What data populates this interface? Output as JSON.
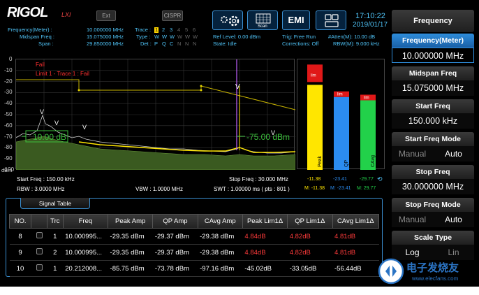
{
  "header": {
    "logo": "RIGOL",
    "logo_sub": "LXI",
    "btn_ext": "Ext",
    "btn_cispr": "CISPR",
    "scan_label": "Scan",
    "emi_label": "EMI",
    "time": "17:10:22",
    "date": "2019/01/17",
    "freq_meter_label": "Frequency(Meter) :",
    "freq_meter_value": "10.000000 MHz",
    "midspan_label": "Midspan Freq :",
    "midspan_value": "15.075000 MHz",
    "span_label": "Span :",
    "span_value": "29.850000 MHz",
    "trace_label": "Trace :",
    "trace_nums": [
      "1",
      "2",
      "3",
      "4",
      "5",
      "6"
    ],
    "type_label": "Type :",
    "type_vals": [
      "W",
      "W",
      "W",
      "W",
      "W",
      "W"
    ],
    "det_label": "Det :",
    "det_vals": [
      "P",
      "Q",
      "C",
      "N",
      "N",
      "N"
    ],
    "ref_level": "Ref Level: 0.00 dBm",
    "state": "State: Idle",
    "trig": "Trig: Free Run",
    "corrections": "Corrections: Off",
    "atten": "#Atten(M): 10.00 dB",
    "rbw_m": "RBW(M): 9.000 kHz"
  },
  "right_panel": {
    "title": "Frequency",
    "items": [
      {
        "label": "Frequency(Meter)",
        "value": "10.000000 MHz"
      },
      {
        "label": "Midspan Freq",
        "value": "15.075000 MHz"
      },
      {
        "label": "Start Freq",
        "value": "150.000 kHz"
      },
      {
        "label": "Start Freq Mode",
        "opt1": "Manual",
        "opt2": "Auto"
      },
      {
        "label": "Stop Freq",
        "value": "30.000000 MHz"
      },
      {
        "label": "Stop Freq Mode",
        "opt1": "Manual",
        "opt2": "Auto"
      },
      {
        "label": "Scale Type",
        "opt1": "Log",
        "opt2": "Lin"
      }
    ]
  },
  "plot": {
    "y_ticks": [
      "0",
      "-10",
      "-20",
      "-30",
      "-40",
      "-50",
      "-60",
      "-70",
      "-80",
      "-90",
      "-100"
    ],
    "y_unit": "dBm",
    "fail_text": "Fail",
    "limit_text": "Limit 1 - Trace 1 : Fail",
    "left_readout": "10.00 dB",
    "right_readout": "-75.00 dBm",
    "start_freq": "Start Freq : 150.00 kHz",
    "rbw": "RBW : 3.0000 MHz",
    "vbw": "VBW : 1.0000 MHz",
    "stop_freq": "Stop Freq : 30.000 MHz",
    "swt": "SWT : 1.00000 ms ( pts : 801 )"
  },
  "bars": {
    "items": [
      {
        "value_top": "-11.38",
        "marker": "M: -11.38",
        "label": "Peak",
        "lim": "lim",
        "level": 0.77,
        "color": "#ffe600"
      },
      {
        "value_top": "-23.41",
        "marker": "M: -23.41",
        "label": "QP",
        "lim": "lim",
        "level": 0.66,
        "color": "#2b8cf0"
      },
      {
        "value_top": "-29.77",
        "marker": "M: 29.77",
        "label": "CAvg",
        "lim": "lim",
        "level": 0.63,
        "color": "#22d14a"
      }
    ]
  },
  "signal_table": {
    "title": "Signal Table",
    "headers": [
      "NO.",
      "",
      "Trc",
      "Freq",
      "Peak Amp",
      "QP Amp",
      "CAvg Amp",
      "Peak Lim1Δ",
      "QP Lim1Δ",
      "CAvg Lim1Δ"
    ],
    "rows": [
      [
        "8",
        "",
        "1",
        "10.000995...",
        "-29.35 dBm",
        "-29.37 dBm",
        "-29.38 dBm",
        "4.84dB",
        "4.82dB",
        "4.81dB"
      ],
      [
        "9",
        "",
        "2",
        "10.000995...",
        "-29.35 dBm",
        "-29.37 dBm",
        "-29.38 dBm",
        "4.84dB",
        "4.82dB",
        "4.81dB"
      ],
      [
        "10",
        "",
        "1",
        "20.212008...",
        "-85.75 dBm",
        "-73.78 dBm",
        "-97.16 dBm",
        "-45.02dB",
        "-33.05dB",
        "-56.44dB"
      ]
    ]
  },
  "watermark": "电子发烧友 www.elecfans.com"
}
